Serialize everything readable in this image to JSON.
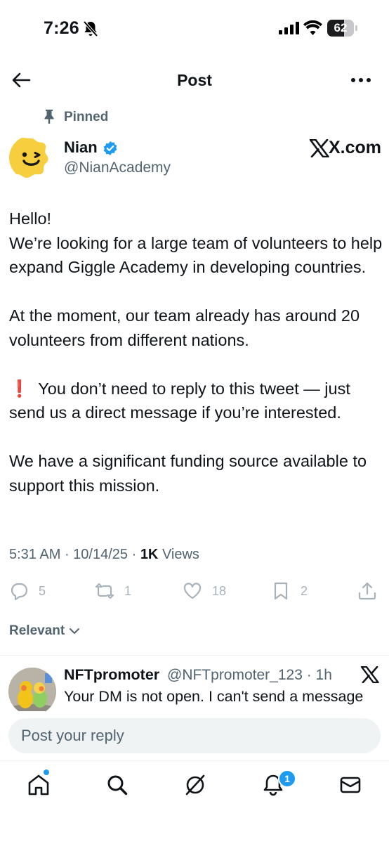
{
  "status_bar": {
    "time": "7:26",
    "battery": "62",
    "battery_level": 0.62
  },
  "header": {
    "title": "Post"
  },
  "pinned": {
    "label": "Pinned"
  },
  "author": {
    "name": "Nian",
    "handle": "@NianAcademy",
    "brand_link": "X.com"
  },
  "post": {
    "lines": {
      "l1": "Hello!",
      "l2": "We’re looking for a large team of volunteers to help expand Giggle Academy in developing countries.",
      "l3": "At the moment, our team already has around 20 volunteers from different nations.",
      "l4": "You don’t need to reply to this tweet — just send us a direct message if you’re interested.",
      "l5": "We have a significant funding source available to support this mission."
    },
    "exclamation": "❗",
    "time": "5:31 AM",
    "sep1": " · ",
    "date": "10/14/25",
    "sep2": " · ",
    "views_count": "1K",
    "views_label": " Views"
  },
  "actions": {
    "replies": "5",
    "reposts": "1",
    "likes": "18",
    "bookmarks": "2"
  },
  "sort": {
    "label": "Relevant"
  },
  "reply": {
    "name": "NFTpromoter",
    "handle": "@NFTpromoter_123 · 1h",
    "text": "Your DM is not open. I can't send a message"
  },
  "composer": {
    "placeholder": "Post your reply"
  },
  "nav": {
    "notifications_badge": "1"
  },
  "colors": {
    "accent": "#1d9bf0",
    "muted": "#536471",
    "alert": "#e0282e",
    "avatar_yellow": "#f7cf3e"
  }
}
